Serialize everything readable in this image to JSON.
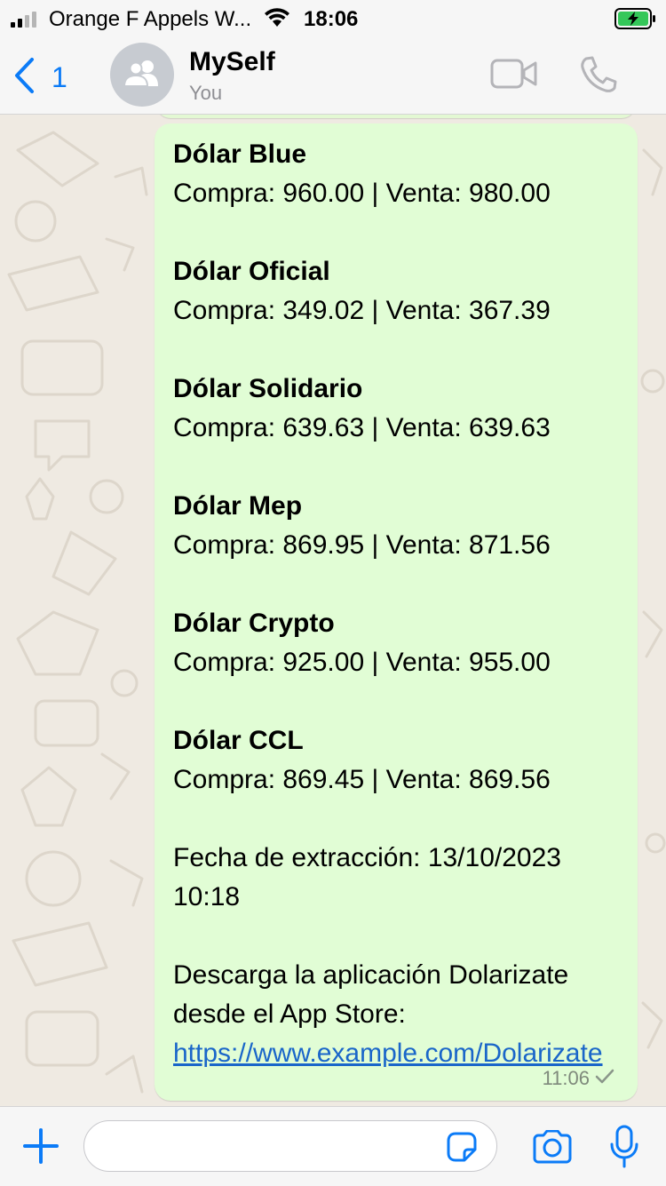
{
  "status_bar": {
    "carrier": "Orange F Appels W...",
    "time": "18:06"
  },
  "header": {
    "back_count": "1",
    "contact_name": "MySelf",
    "contact_subtitle": "You"
  },
  "message": {
    "rates": [
      {
        "name": "Dólar Blue",
        "line": "Compra: 960.00 | Venta: 980.00"
      },
      {
        "name": "Dólar Oficial",
        "line": "Compra: 349.02 | Venta: 367.39"
      },
      {
        "name": "Dólar Solidario",
        "line": "Compra: 639.63 | Venta: 639.63"
      },
      {
        "name": "Dólar Mep",
        "line": "Compra: 869.95 | Venta: 871.56"
      },
      {
        "name": "Dólar Crypto",
        "line": "Compra: 925.00 | Venta: 955.00"
      },
      {
        "name": "Dólar CCL",
        "line": "Compra: 869.45 | Venta: 869.56"
      }
    ],
    "date_line": "Fecha de extracción: 13/10/2023 10:18",
    "download_text": "Descarga la aplicación Dolarizate desde el App Store: ",
    "link": "https://www.example.com/Dolarizate",
    "time": "11:06"
  },
  "colors": {
    "accent_blue": "#0b7bf7",
    "bubble_green": "#e1fdd5",
    "chat_background": "#efeae2",
    "link_blue": "#1a66c9"
  },
  "icons": {
    "back": "chevron-left-icon",
    "avatar": "group-icon",
    "video": "video-camera-icon",
    "call": "phone-icon",
    "attach": "plus-icon",
    "sticker": "sticker-icon",
    "camera": "camera-icon",
    "mic": "microphone-icon",
    "tick": "checkmark-icon"
  },
  "input": {
    "placeholder": ""
  }
}
